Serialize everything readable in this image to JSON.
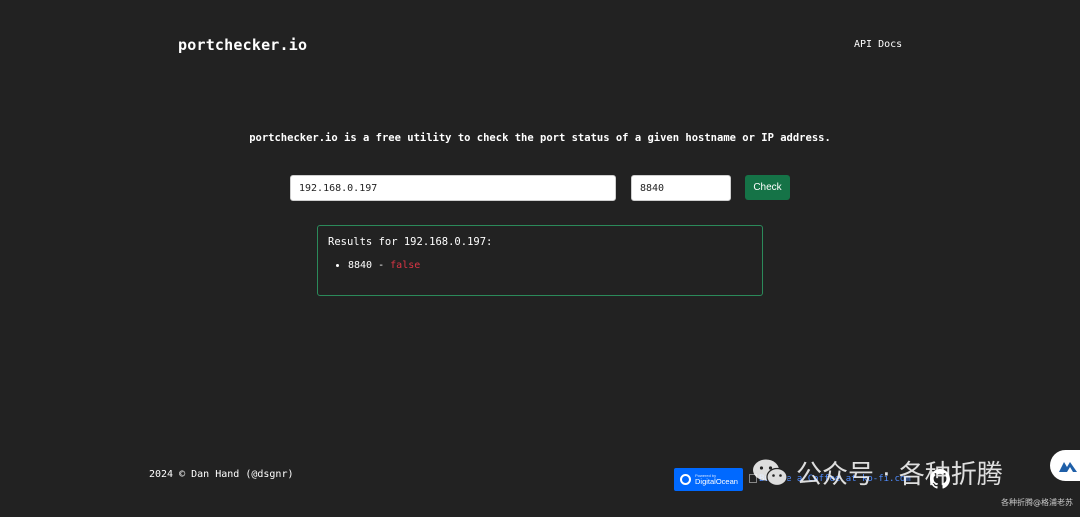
{
  "header": {
    "logo": "portchecker.io",
    "nav": {
      "api_docs": "API Docs"
    }
  },
  "main": {
    "tagline": "portchecker.io is a free utility to check the port status of a given hostname or IP address.",
    "form": {
      "host_value": "192.168.0.197",
      "port_value": "8840",
      "check_label": "Check"
    },
    "results": {
      "title": "Results for 192.168.0.197:",
      "items": [
        {
          "port": "8840",
          "separator": " - ",
          "status": "false"
        }
      ]
    }
  },
  "footer": {
    "copyright": "2024 © Dan Hand (@dsgnr)",
    "do_badge_small": "Powered by",
    "do_badge_name": "DigitalOcean",
    "kofi_alt": "Buy Me a Coffee at ko-fi.com"
  },
  "watermark": {
    "text": "公众号 · 各种折腾",
    "sub": "各种折腾@格浦老苏"
  },
  "colors": {
    "background": "#222222",
    "accent": "#157347",
    "results_border": "#2b8a5a",
    "false_status": "#dc3545",
    "do_blue": "#0069ff"
  }
}
